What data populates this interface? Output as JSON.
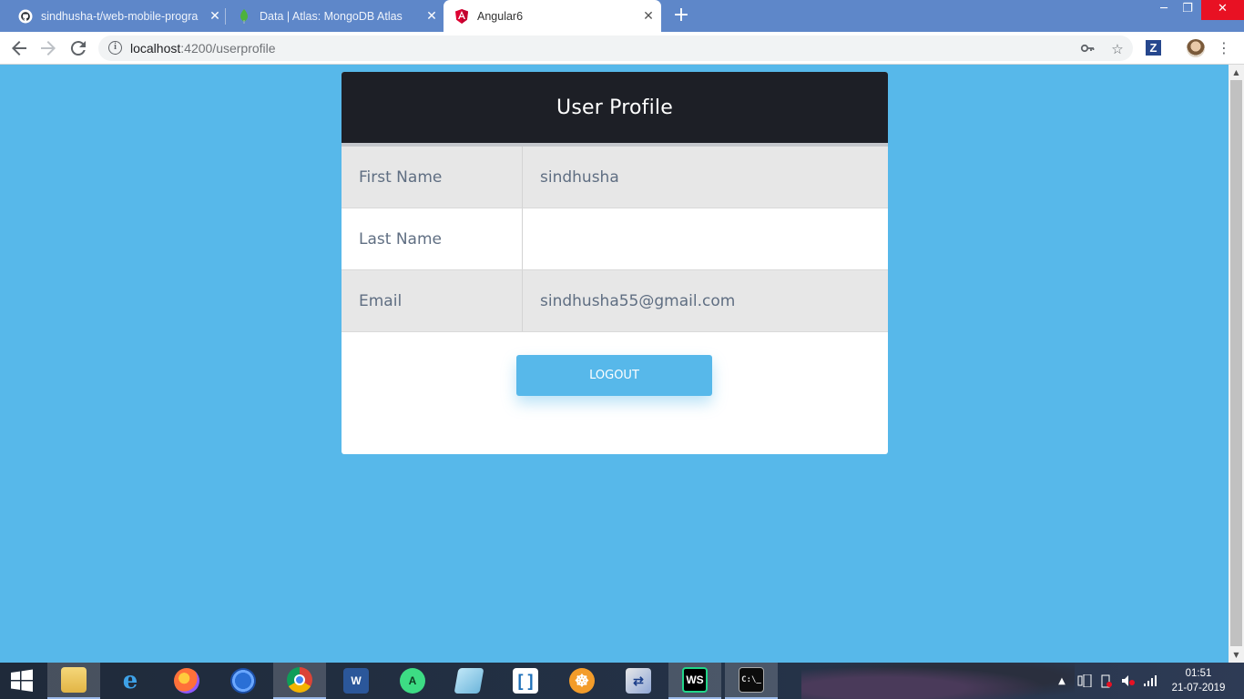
{
  "browser": {
    "tabs": [
      {
        "title": "sindhusha-t/web-mobile-progra",
        "icon": "github-icon"
      },
      {
        "title": "Data | Atlas: MongoDB Atlas",
        "icon": "mongodb-leaf-icon"
      },
      {
        "title": "Angular6",
        "icon": "angular-icon"
      }
    ],
    "url_host": "localhost",
    "url_path": ":4200/userprofile"
  },
  "profile": {
    "title": "User Profile",
    "rows": [
      {
        "label": "First Name",
        "value": "sindhusha"
      },
      {
        "label": "Last Name",
        "value": ""
      },
      {
        "label": "Email",
        "value": "sindhusha55@gmail.com"
      }
    ],
    "logout_label": "LOGOUT"
  },
  "taskbar": {
    "time": "01:51",
    "date": "21-07-2019"
  },
  "colors": {
    "page_bg": "#57b8ea",
    "header_bg": "#1d1f26",
    "button_bg": "#57b8ea",
    "tabstrip_bg": "#5e87c9"
  }
}
